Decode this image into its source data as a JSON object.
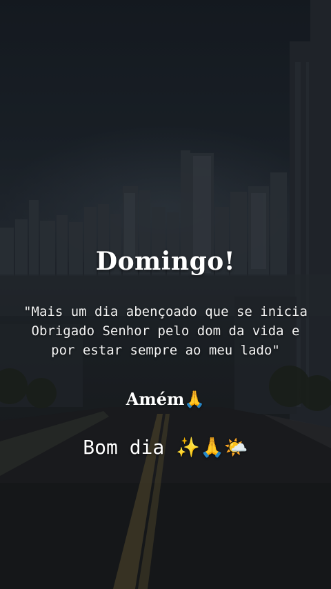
{
  "post": {
    "title": "Domingo!",
    "quote": "\"Mais um dia abençoado que se inicia Obrigado Senhor pelo dom da vida e por estar sempre ao meu lado\"",
    "amen": "Amém",
    "amen_emoji": "🙏",
    "greeting": "Bom dia",
    "greeting_emojis": "✨🙏🌤️"
  },
  "background": {
    "scene": "city-skyline-road",
    "colors": {
      "sky": "#1b2129",
      "road": "#1e1f21",
      "text": "#ffffff"
    }
  }
}
